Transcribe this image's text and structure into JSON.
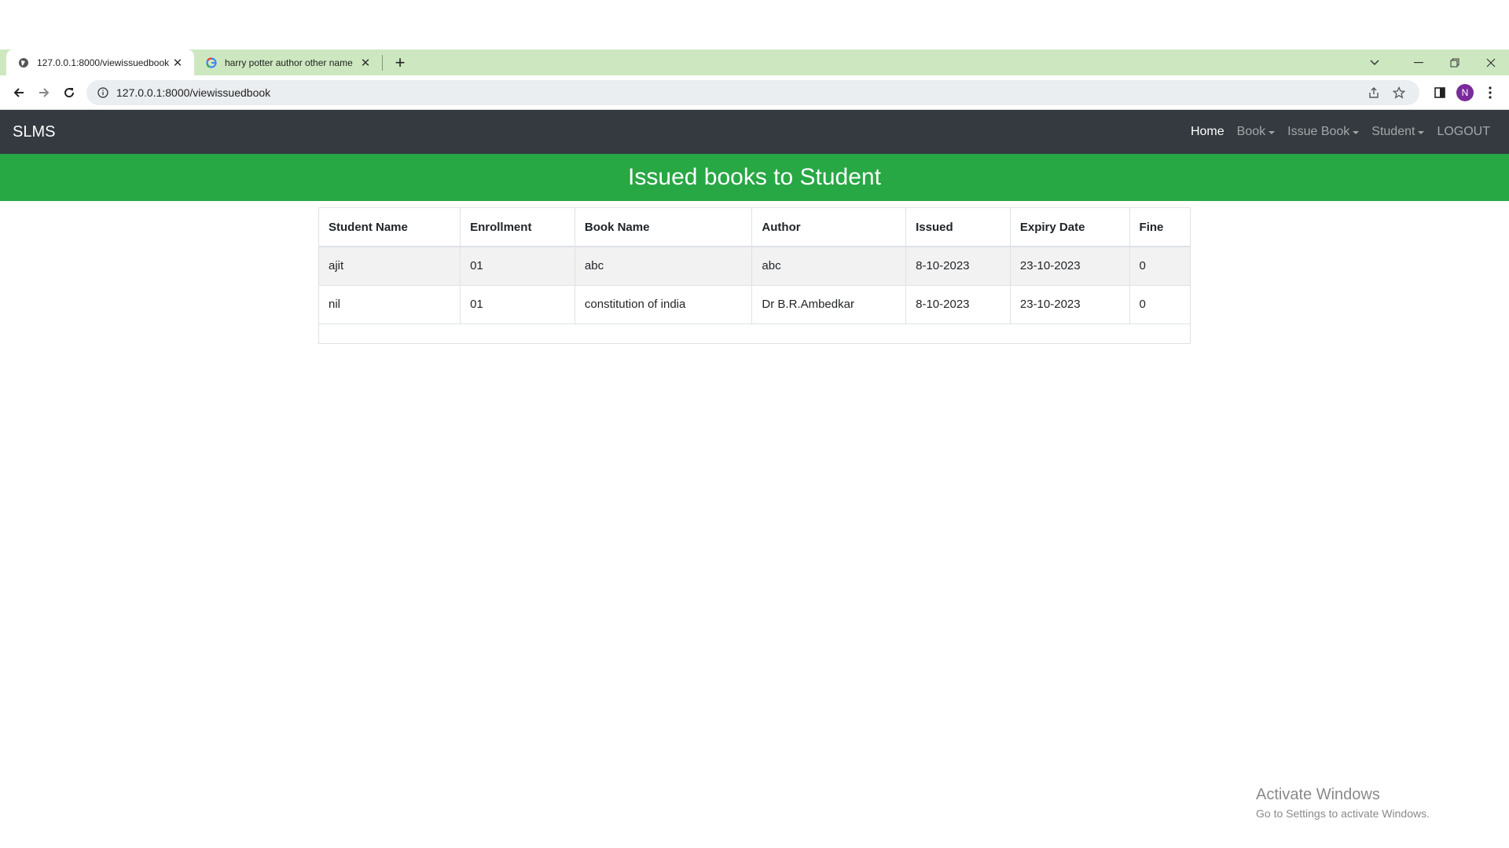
{
  "browser": {
    "tabs": [
      {
        "title": "127.0.0.1:8000/viewissuedbook",
        "active": true
      },
      {
        "title": "harry potter author other name",
        "active": false
      }
    ],
    "url": "127.0.0.1:8000/viewissuedbook",
    "profile_initial": "N"
  },
  "app": {
    "brand": "SLMS",
    "nav": [
      {
        "label": "Home",
        "active": true,
        "dropdown": false
      },
      {
        "label": "Book",
        "active": false,
        "dropdown": true
      },
      {
        "label": "Issue Book",
        "active": false,
        "dropdown": true
      },
      {
        "label": "Student",
        "active": false,
        "dropdown": true
      },
      {
        "label": "LOGOUT",
        "active": false,
        "dropdown": false
      }
    ],
    "page_title": "Issued books to Student",
    "table": {
      "headers": [
        "Student Name",
        "Enrollment",
        "Book Name",
        "Author",
        "Issued",
        "Expiry Date",
        "Fine"
      ],
      "rows": [
        [
          "ajit",
          "01",
          "abc",
          "abc",
          "8-10-2023",
          "23-10-2023",
          "0"
        ],
        [
          "nil",
          "01",
          "constitution of india",
          "Dr B.R.Ambedkar",
          "8-10-2023",
          "23-10-2023",
          "0"
        ]
      ]
    }
  },
  "watermark": {
    "line1": "Activate Windows",
    "line2": "Go to Settings to activate Windows."
  },
  "colors": {
    "tabstrip": "#cde8c0",
    "navbar": "#343a40",
    "banner": "#28a745",
    "avatar": "#7b2a9c"
  }
}
